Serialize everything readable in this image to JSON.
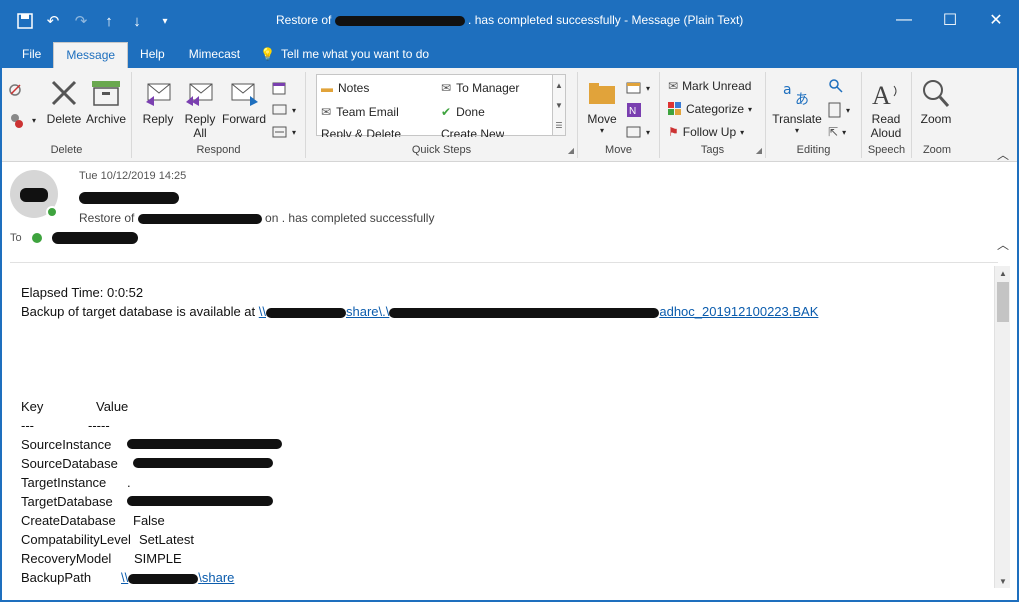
{
  "titlebar": {
    "title_prefix": "Restore of",
    "title_suffix": ". has completed successfully  -  Message (Plain Text)",
    "icons": [
      "save-icon",
      "undo-icon",
      "redo-icon",
      "up-arrow-icon",
      "down-arrow-icon",
      "customize-qat-icon"
    ],
    "window_controls": [
      "minimize",
      "restore",
      "close"
    ]
  },
  "tabs": [
    "File",
    "Message",
    "Help",
    "Mimecast"
  ],
  "active_tab": "Message",
  "tell_me": "Tell me what you want to do",
  "ribbon": {
    "delete_group": {
      "label": "Delete",
      "delete": "Delete",
      "archive": "Archive"
    },
    "respond_group": {
      "label": "Respond",
      "reply": "Reply",
      "reply_all_1": "Reply",
      "reply_all_2": "All",
      "forward": "Forward"
    },
    "quick_steps": {
      "label": "Quick Steps",
      "items": [
        "Notes",
        "To Manager",
        "Team Email",
        "Done",
        "Reply & Delete",
        "Create New"
      ]
    },
    "move_group": {
      "label": "Move",
      "move": "Move"
    },
    "tags_group": {
      "label": "Tags",
      "mark_unread": "Mark Unread",
      "categorize": "Categorize",
      "follow_up": "Follow Up"
    },
    "editing_group": {
      "label": "Editing",
      "translate": "Translate"
    },
    "speech_group": {
      "label": "Speech",
      "read_aloud_1": "Read",
      "read_aloud_2": "Aloud"
    },
    "zoom_group": {
      "label": "Zoom",
      "zoom": "Zoom"
    }
  },
  "header": {
    "date": "Tue 10/12/2019 14:25",
    "subject_prefix": "Restore of",
    "subject_suffix": "on . has completed successfully",
    "to_label": "To"
  },
  "body": {
    "elapsed": "Elapsed Time: 0:0:52",
    "backup_prefix": "Backup of target database is available at ",
    "backup_link_start": "\\\\",
    "backup_link_mid": "share\\.\\",
    "backup_link_end": "adhoc_201912100223.BAK",
    "table_header": {
      "key": "Key",
      "value": "Value"
    },
    "table_dashes": {
      "key": "---",
      "value": "-----"
    },
    "rows": [
      {
        "key": "SourceInstance",
        "value": ""
      },
      {
        "key": "SourceDatabase",
        "value": ""
      },
      {
        "key": "TargetInstance",
        "value": "."
      },
      {
        "key": "TargetDatabase",
        "value": ""
      },
      {
        "key": "CreateDatabase",
        "value": "False"
      },
      {
        "key": "CompatabilityLevel",
        "value": "SetLatest"
      },
      {
        "key": "RecoveryModel",
        "value": "SIMPLE"
      },
      {
        "key": "BackupPath",
        "value": "share"
      }
    ]
  },
  "colors": {
    "title_blue": "#1e6fbe",
    "ribbon_bg": "#f3f3f3",
    "link": "#0b5cad",
    "presence": "#3ea33e"
  }
}
